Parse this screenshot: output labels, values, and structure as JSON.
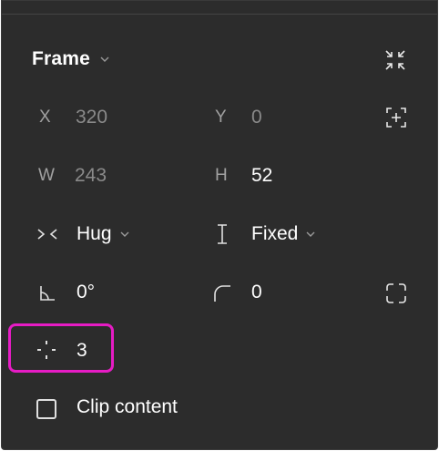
{
  "panel": {
    "title": "Frame"
  },
  "position": {
    "x_label": "X",
    "x_value": "320",
    "y_label": "Y",
    "y_value": "0"
  },
  "size": {
    "w_label": "W",
    "w_value": "243",
    "h_label": "H",
    "h_value": "52"
  },
  "resizing": {
    "horizontal_value": "Hug",
    "vertical_value": "Fixed"
  },
  "transform": {
    "rotation_value": "0°",
    "corner_radius_value": "0"
  },
  "layout": {
    "gap_value": "3"
  },
  "clip": {
    "label": "Clip content",
    "checked": false
  },
  "colors": {
    "panel_bg": "#2c2c2c",
    "highlight": "#e61cc4"
  },
  "icons": {
    "collapse": "collapse-arrows-icon",
    "crosshair": "resize-to-fit-icon",
    "hug": "hug-horizontal-icon",
    "fixed": "fixed-vertical-icon",
    "rotation": "rotation-angle-icon",
    "corner": "corner-radius-icon",
    "independent_corners": "independent-corners-icon",
    "gap": "spacing-gap-icon"
  }
}
